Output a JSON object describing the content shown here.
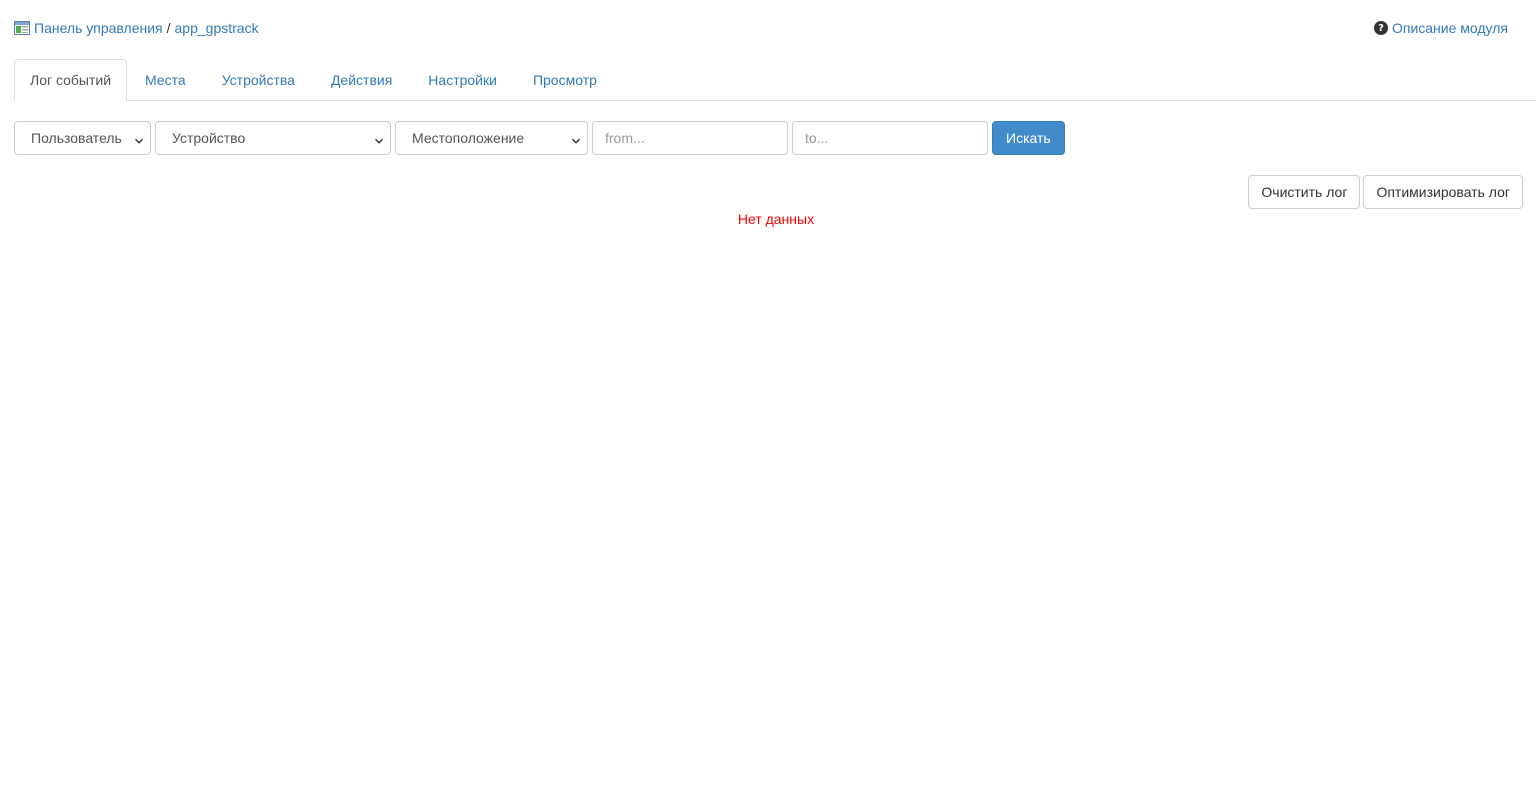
{
  "breadcrumb": {
    "icon": "module-window-icon",
    "home": "Панель управления",
    "separator": "/",
    "current": "app_gpstrack"
  },
  "help": {
    "icon": "question-circle-icon",
    "label": "Описание модуля"
  },
  "tabs": [
    {
      "label": "Лог событий",
      "active": true
    },
    {
      "label": "Места",
      "active": false
    },
    {
      "label": "Устройства",
      "active": false
    },
    {
      "label": "Действия",
      "active": false
    },
    {
      "label": "Настройки",
      "active": false
    },
    {
      "label": "Просмотр",
      "active": false
    }
  ],
  "filters": {
    "user_select": "Пользователь",
    "device_select": "Устройство",
    "location_select": "Местоположение",
    "from_placeholder": "from...",
    "to_placeholder": "to...",
    "search_button": "Искать"
  },
  "actions": {
    "clear_log": "Очистить лог",
    "optimize_log": "Оптимизировать лог"
  },
  "status": {
    "no_data": "Нет данных"
  },
  "colors": {
    "link": "#337ab7",
    "primary": "#428bca",
    "error": "#ff0000"
  }
}
